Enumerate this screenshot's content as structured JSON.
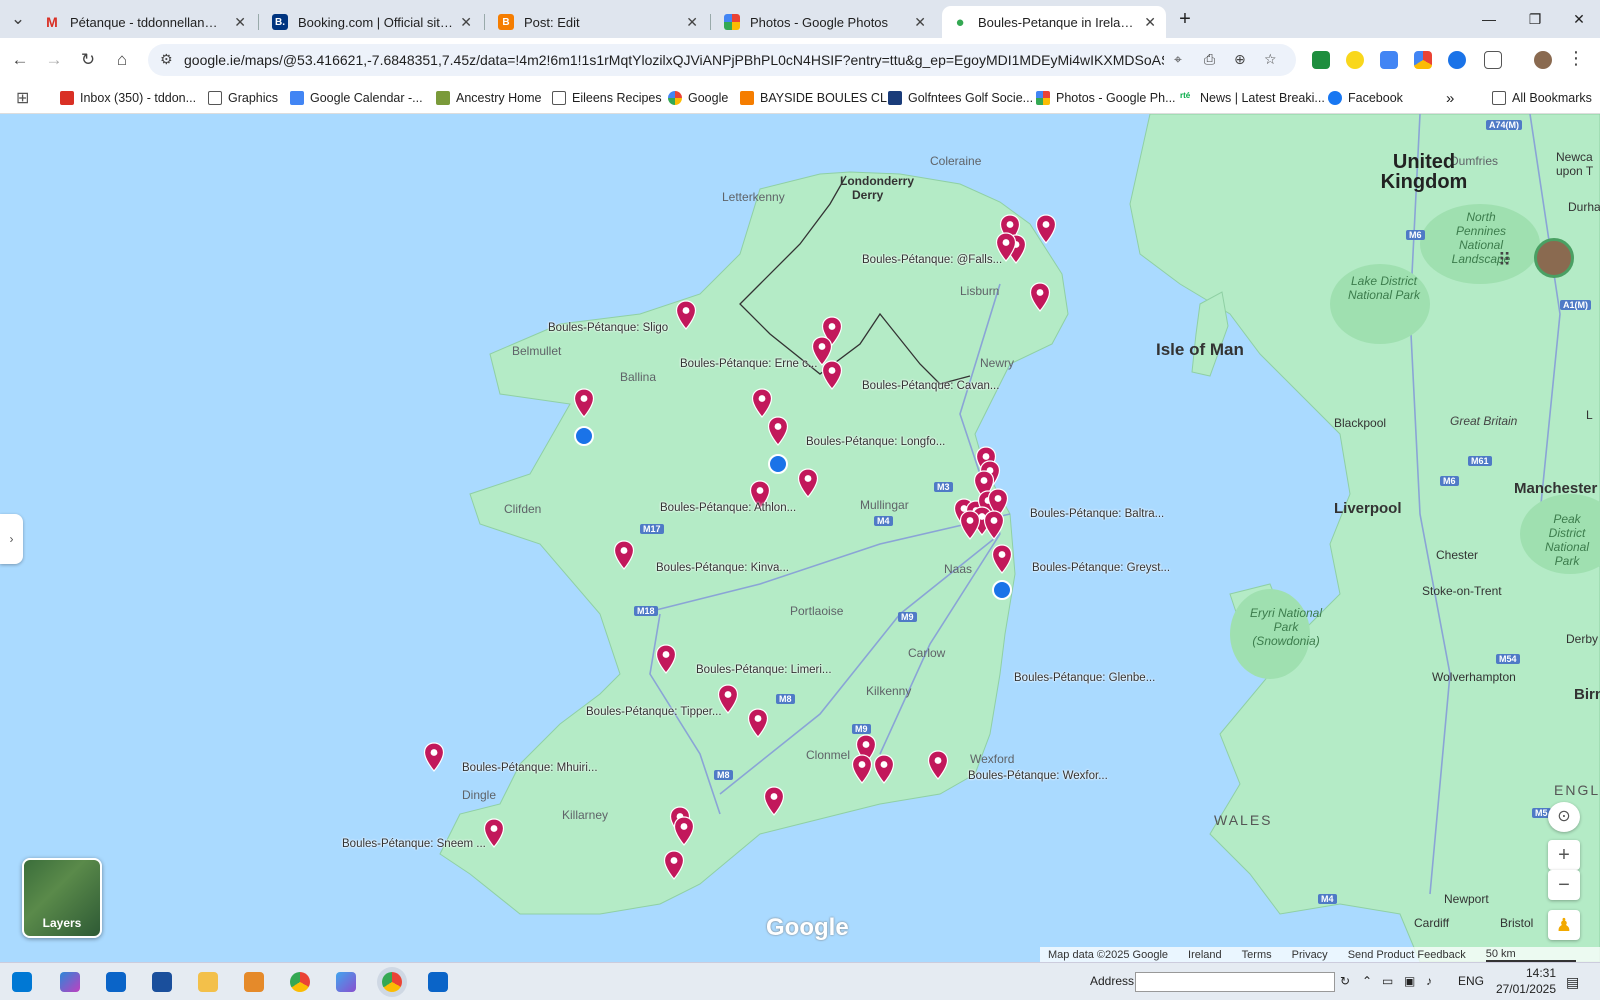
{
  "tabs": [
    {
      "title": "Pétanque - tddonnellan@gmail",
      "icon": "gmail-icon",
      "color": "#d93025"
    },
    {
      "title": "Booking.com | Official site | The",
      "icon": "booking-icon",
      "color": "#003580"
    },
    {
      "title": "Post: Edit",
      "icon": "blogger-icon",
      "color": "#f57d00"
    },
    {
      "title": "Photos - Google Photos",
      "icon": "google-photos-icon",
      "color": "#fbbc04"
    },
    {
      "title": "Boules-Petanque in Ireland as c",
      "icon": "google-maps-icon",
      "color": "#34a853"
    }
  ],
  "toolbar": {
    "url": "google.ie/maps/@53.416621,-7.6848351,7.45z/data=!4m2!6m1!1s1rMqtYlozilxQJViANPjPBhPL0cN4HSIF?entry=ttu&g_ep=EgoyMDI1MDEyMi4wIKXMDSoASAFQAw..."
  },
  "bookmarks": [
    {
      "label": "Inbox (350) - tddon...",
      "icon": "gmail-icon"
    },
    {
      "label": "Graphics",
      "icon": "folder-icon"
    },
    {
      "label": "Google Calendar -...",
      "icon": "calendar-icon"
    },
    {
      "label": "Ancestry Home",
      "icon": "ancestry-icon"
    },
    {
      "label": "Eileens Recipes",
      "icon": "folder-icon"
    },
    {
      "label": "Google",
      "icon": "google-icon"
    },
    {
      "label": "BAYSIDE BOULES CL...",
      "icon": "blogger-icon"
    },
    {
      "label": "Golfntees Golf Socie...",
      "icon": "golf-icon"
    },
    {
      "label": "Photos - Google Ph...",
      "icon": "google-photos-icon"
    },
    {
      "label": "News | Latest Breaki...",
      "icon": "rte-icon"
    },
    {
      "label": "Facebook",
      "icon": "facebook-icon"
    }
  ],
  "all_bookmarks": "All Bookmarks",
  "map": {
    "places": [
      {
        "name": "Coleraine"
      },
      {
        "name": "Londonderry"
      },
      {
        "name": "Derry"
      },
      {
        "name": "Letterkenny"
      },
      {
        "name": "Lisburn"
      },
      {
        "name": "Newry"
      },
      {
        "name": "Belmullet"
      },
      {
        "name": "Ballina"
      },
      {
        "name": "Clifden"
      },
      {
        "name": "Mullingar"
      },
      {
        "name": "Naas"
      },
      {
        "name": "Portlaoise"
      },
      {
        "name": "Carlow"
      },
      {
        "name": "Kilkenny"
      },
      {
        "name": "Clonmel"
      },
      {
        "name": "Wexford"
      },
      {
        "name": "Dingle"
      },
      {
        "name": "Killarney"
      },
      {
        "name": "Dumfries"
      },
      {
        "name": "Blackpool"
      },
      {
        "name": "Liverpool"
      },
      {
        "name": "Manchester"
      },
      {
        "name": "Chester"
      },
      {
        "name": "Stoke-on-Trent"
      },
      {
        "name": "Wolverhampton"
      },
      {
        "name": "Birn"
      },
      {
        "name": "Newport"
      },
      {
        "name": "Cardiff"
      },
      {
        "name": "Bristol"
      },
      {
        "name": "Newca upon T"
      },
      {
        "name": "Durha"
      },
      {
        "name": "Derby"
      },
      {
        "name": "L"
      }
    ],
    "countries": [
      {
        "name": "United Kingdom"
      },
      {
        "name": "WALES"
      },
      {
        "name": "ENGLA"
      }
    ],
    "islands": [
      {
        "name": "Isle of Man"
      },
      {
        "name": "Great Britain"
      }
    ],
    "parks": [
      {
        "name": "North Pennines National Landscape"
      },
      {
        "name": "Lake District National Park"
      },
      {
        "name": "Peak District National Park"
      },
      {
        "name": "Eryri National Park (Snowdonia)"
      }
    ],
    "pin_labels": [
      "Boules-Pétanque: @Falls...",
      "Boules-Pétanque: Sligo",
      "Boules-Pétanque: Erne c...",
      "Boules-Pétanque: Cavan...",
      "Boules-Pétanque: Longfo...",
      "Boules-Pétanque: Athlon...",
      "Boules-Pétanque: Baltra...",
      "Boules-Pétanque: Greyst...",
      "Boules-Pétanque: Kinva...",
      "Boules-Pétanque: Limeri...",
      "Boules-Pétanque: Tipper...",
      "Boules-Pétanque: Glenbe...",
      "Boules-Pétanque: Wexfor...",
      "Boules-Pétanque: Mhuiri...",
      "Boules-Pétanque: Sneem ..."
    ],
    "roads": [
      "A74(M)",
      "M6",
      "A1(M)",
      "M3",
      "M4",
      "M17",
      "M18",
      "M9",
      "M8",
      "M9",
      "M8",
      "M61",
      "M6",
      "M54",
      "M5",
      "M4"
    ],
    "layers_label": "Layers",
    "google_logo": "Google",
    "attribution": [
      "Map data ©2025 Google",
      "Ireland",
      "Terms",
      "Privacy",
      "Send Product Feedback",
      "50 km"
    ]
  },
  "taskbar": {
    "address_label": "Address",
    "lang": "ENG",
    "time": "14:31",
    "date": "27/01/2025"
  },
  "colors": {
    "pin": "#c2185b",
    "land": "#b4ebc6",
    "sea": "#aadaff",
    "accent": "#1a73e8"
  }
}
